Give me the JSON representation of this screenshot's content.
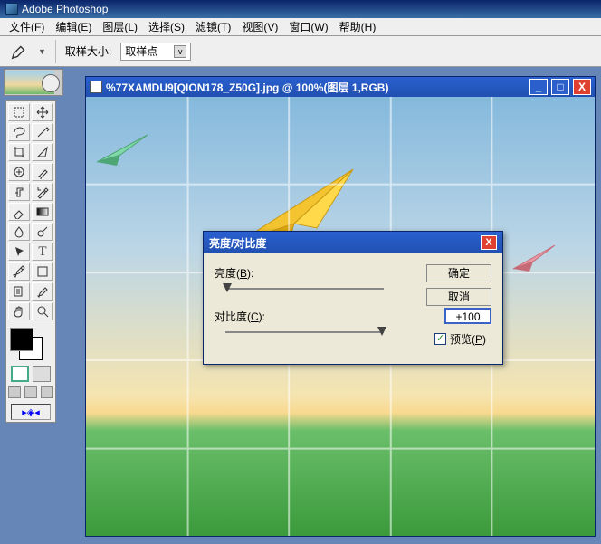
{
  "app": {
    "title": "Adobe Photoshop"
  },
  "menu": {
    "items": [
      "文件(F)",
      "编辑(E)",
      "图层(L)",
      "选择(S)",
      "滤镜(T)",
      "视图(V)",
      "窗口(W)",
      "帮助(H)"
    ]
  },
  "options": {
    "sample_label": "取样大小:",
    "sample_value": "取样点"
  },
  "toolbox": {
    "tools": [
      {
        "name": "marquee",
        "glyph": ""
      },
      {
        "name": "move",
        "glyph": ""
      },
      {
        "name": "lasso",
        "glyph": ""
      },
      {
        "name": "wand",
        "glyph": ""
      },
      {
        "name": "crop",
        "glyph": ""
      },
      {
        "name": "slice",
        "glyph": ""
      },
      {
        "name": "heal",
        "glyph": ""
      },
      {
        "name": "brush",
        "glyph": ""
      },
      {
        "name": "clone",
        "glyph": ""
      },
      {
        "name": "history-brush",
        "glyph": ""
      },
      {
        "name": "eraser",
        "glyph": ""
      },
      {
        "name": "gradient",
        "glyph": ""
      },
      {
        "name": "blur",
        "glyph": ""
      },
      {
        "name": "dodge",
        "glyph": ""
      },
      {
        "name": "path-select",
        "glyph": ""
      },
      {
        "name": "type",
        "glyph": "T"
      },
      {
        "name": "pen",
        "glyph": ""
      },
      {
        "name": "shape",
        "glyph": ""
      },
      {
        "name": "notes",
        "glyph": ""
      },
      {
        "name": "eyedropper",
        "glyph": ""
      },
      {
        "name": "hand",
        "glyph": ""
      },
      {
        "name": "zoom",
        "glyph": ""
      }
    ],
    "jump": "▸◈◂"
  },
  "document": {
    "title": "%77XAMDU9[QION178_Z50G].jpg @ 100%(图层 1,RGB)"
  },
  "dialog": {
    "title": "亮度/对比度",
    "brightness": {
      "label": "亮度(B):",
      "key": "B",
      "value": "-100"
    },
    "contrast": {
      "label": "对比度(C):",
      "key": "C",
      "value": "+100"
    },
    "ok": "确定",
    "cancel": "取消",
    "preview": "预览(P)",
    "preview_key": "P",
    "checked": "✓"
  }
}
